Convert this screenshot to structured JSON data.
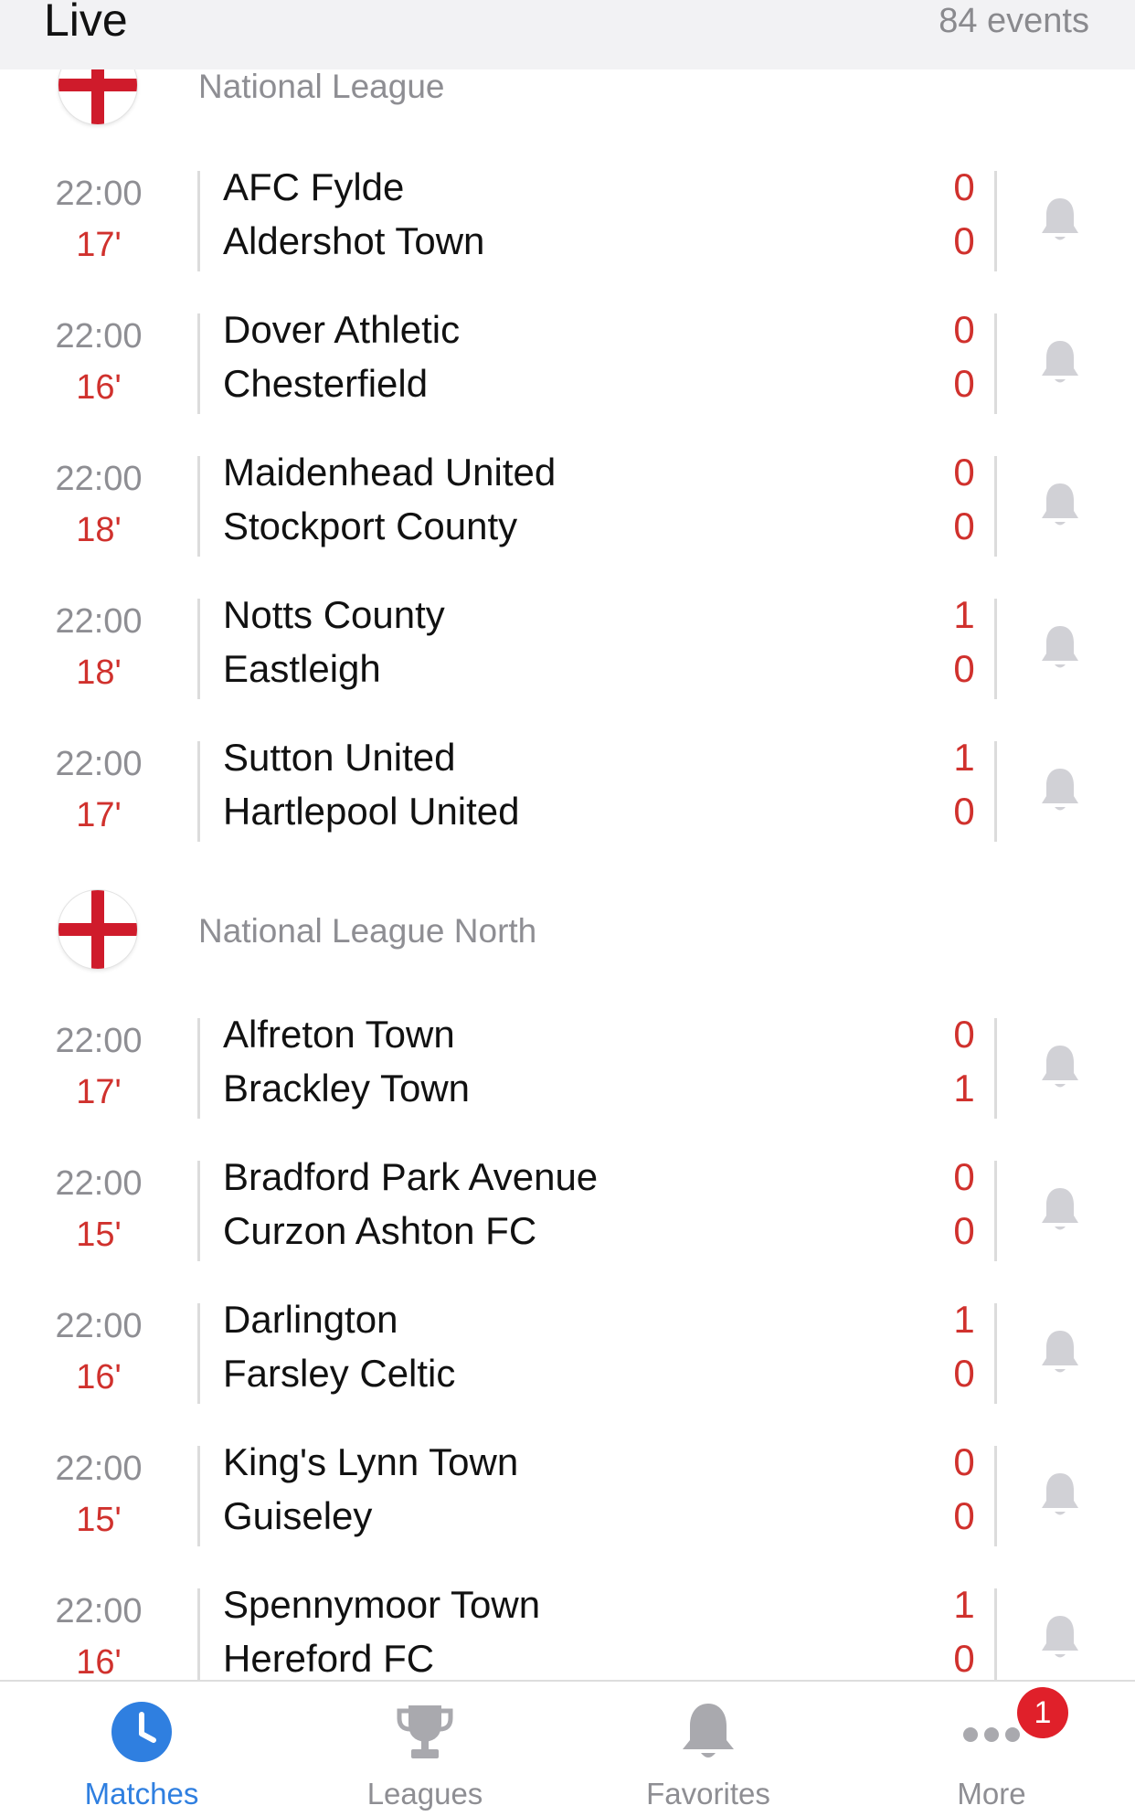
{
  "header": {
    "title": "Live",
    "events_count": "84 events"
  },
  "leagues": [
    {
      "name": "National League",
      "matches": [
        {
          "time": "22:00",
          "minute": "17'",
          "home": "AFC Fylde",
          "away": "Aldershot Town",
          "home_score": "0",
          "away_score": "0"
        },
        {
          "time": "22:00",
          "minute": "16'",
          "home": "Dover Athletic",
          "away": "Chesterfield",
          "home_score": "0",
          "away_score": "0"
        },
        {
          "time": "22:00",
          "minute": "18'",
          "home": "Maidenhead United",
          "away": "Stockport County",
          "home_score": "0",
          "away_score": "0"
        },
        {
          "time": "22:00",
          "minute": "18'",
          "home": "Notts County",
          "away": "Eastleigh",
          "home_score": "1",
          "away_score": "0"
        },
        {
          "time": "22:00",
          "minute": "17'",
          "home": "Sutton United",
          "away": "Hartlepool United",
          "home_score": "1",
          "away_score": "0"
        }
      ]
    },
    {
      "name": "National League North",
      "matches": [
        {
          "time": "22:00",
          "minute": "17'",
          "home": "Alfreton Town",
          "away": "Brackley Town",
          "home_score": "0",
          "away_score": "1"
        },
        {
          "time": "22:00",
          "minute": "15'",
          "home": "Bradford Park Avenue",
          "away": "Curzon Ashton FC",
          "home_score": "0",
          "away_score": "0"
        },
        {
          "time": "22:00",
          "minute": "16'",
          "home": "Darlington",
          "away": "Farsley Celtic",
          "home_score": "1",
          "away_score": "0"
        },
        {
          "time": "22:00",
          "minute": "15'",
          "home": "King's Lynn Town",
          "away": "Guiseley",
          "home_score": "0",
          "away_score": "0"
        },
        {
          "time": "22:00",
          "minute": "16'",
          "home": "Spennymoor Town",
          "away": "Hereford FC",
          "home_score": "1",
          "away_score": "0"
        }
      ]
    }
  ],
  "tabbar": {
    "matches": "Matches",
    "leagues": "Leagues",
    "favorites": "Favorites",
    "more": "More",
    "more_badge": "1",
    "active_color": "#2f7fe0",
    "inactive_color": "#8e8e93"
  },
  "colors": {
    "live_red": "#d0312d",
    "flag_red": "#cf1b2b"
  }
}
